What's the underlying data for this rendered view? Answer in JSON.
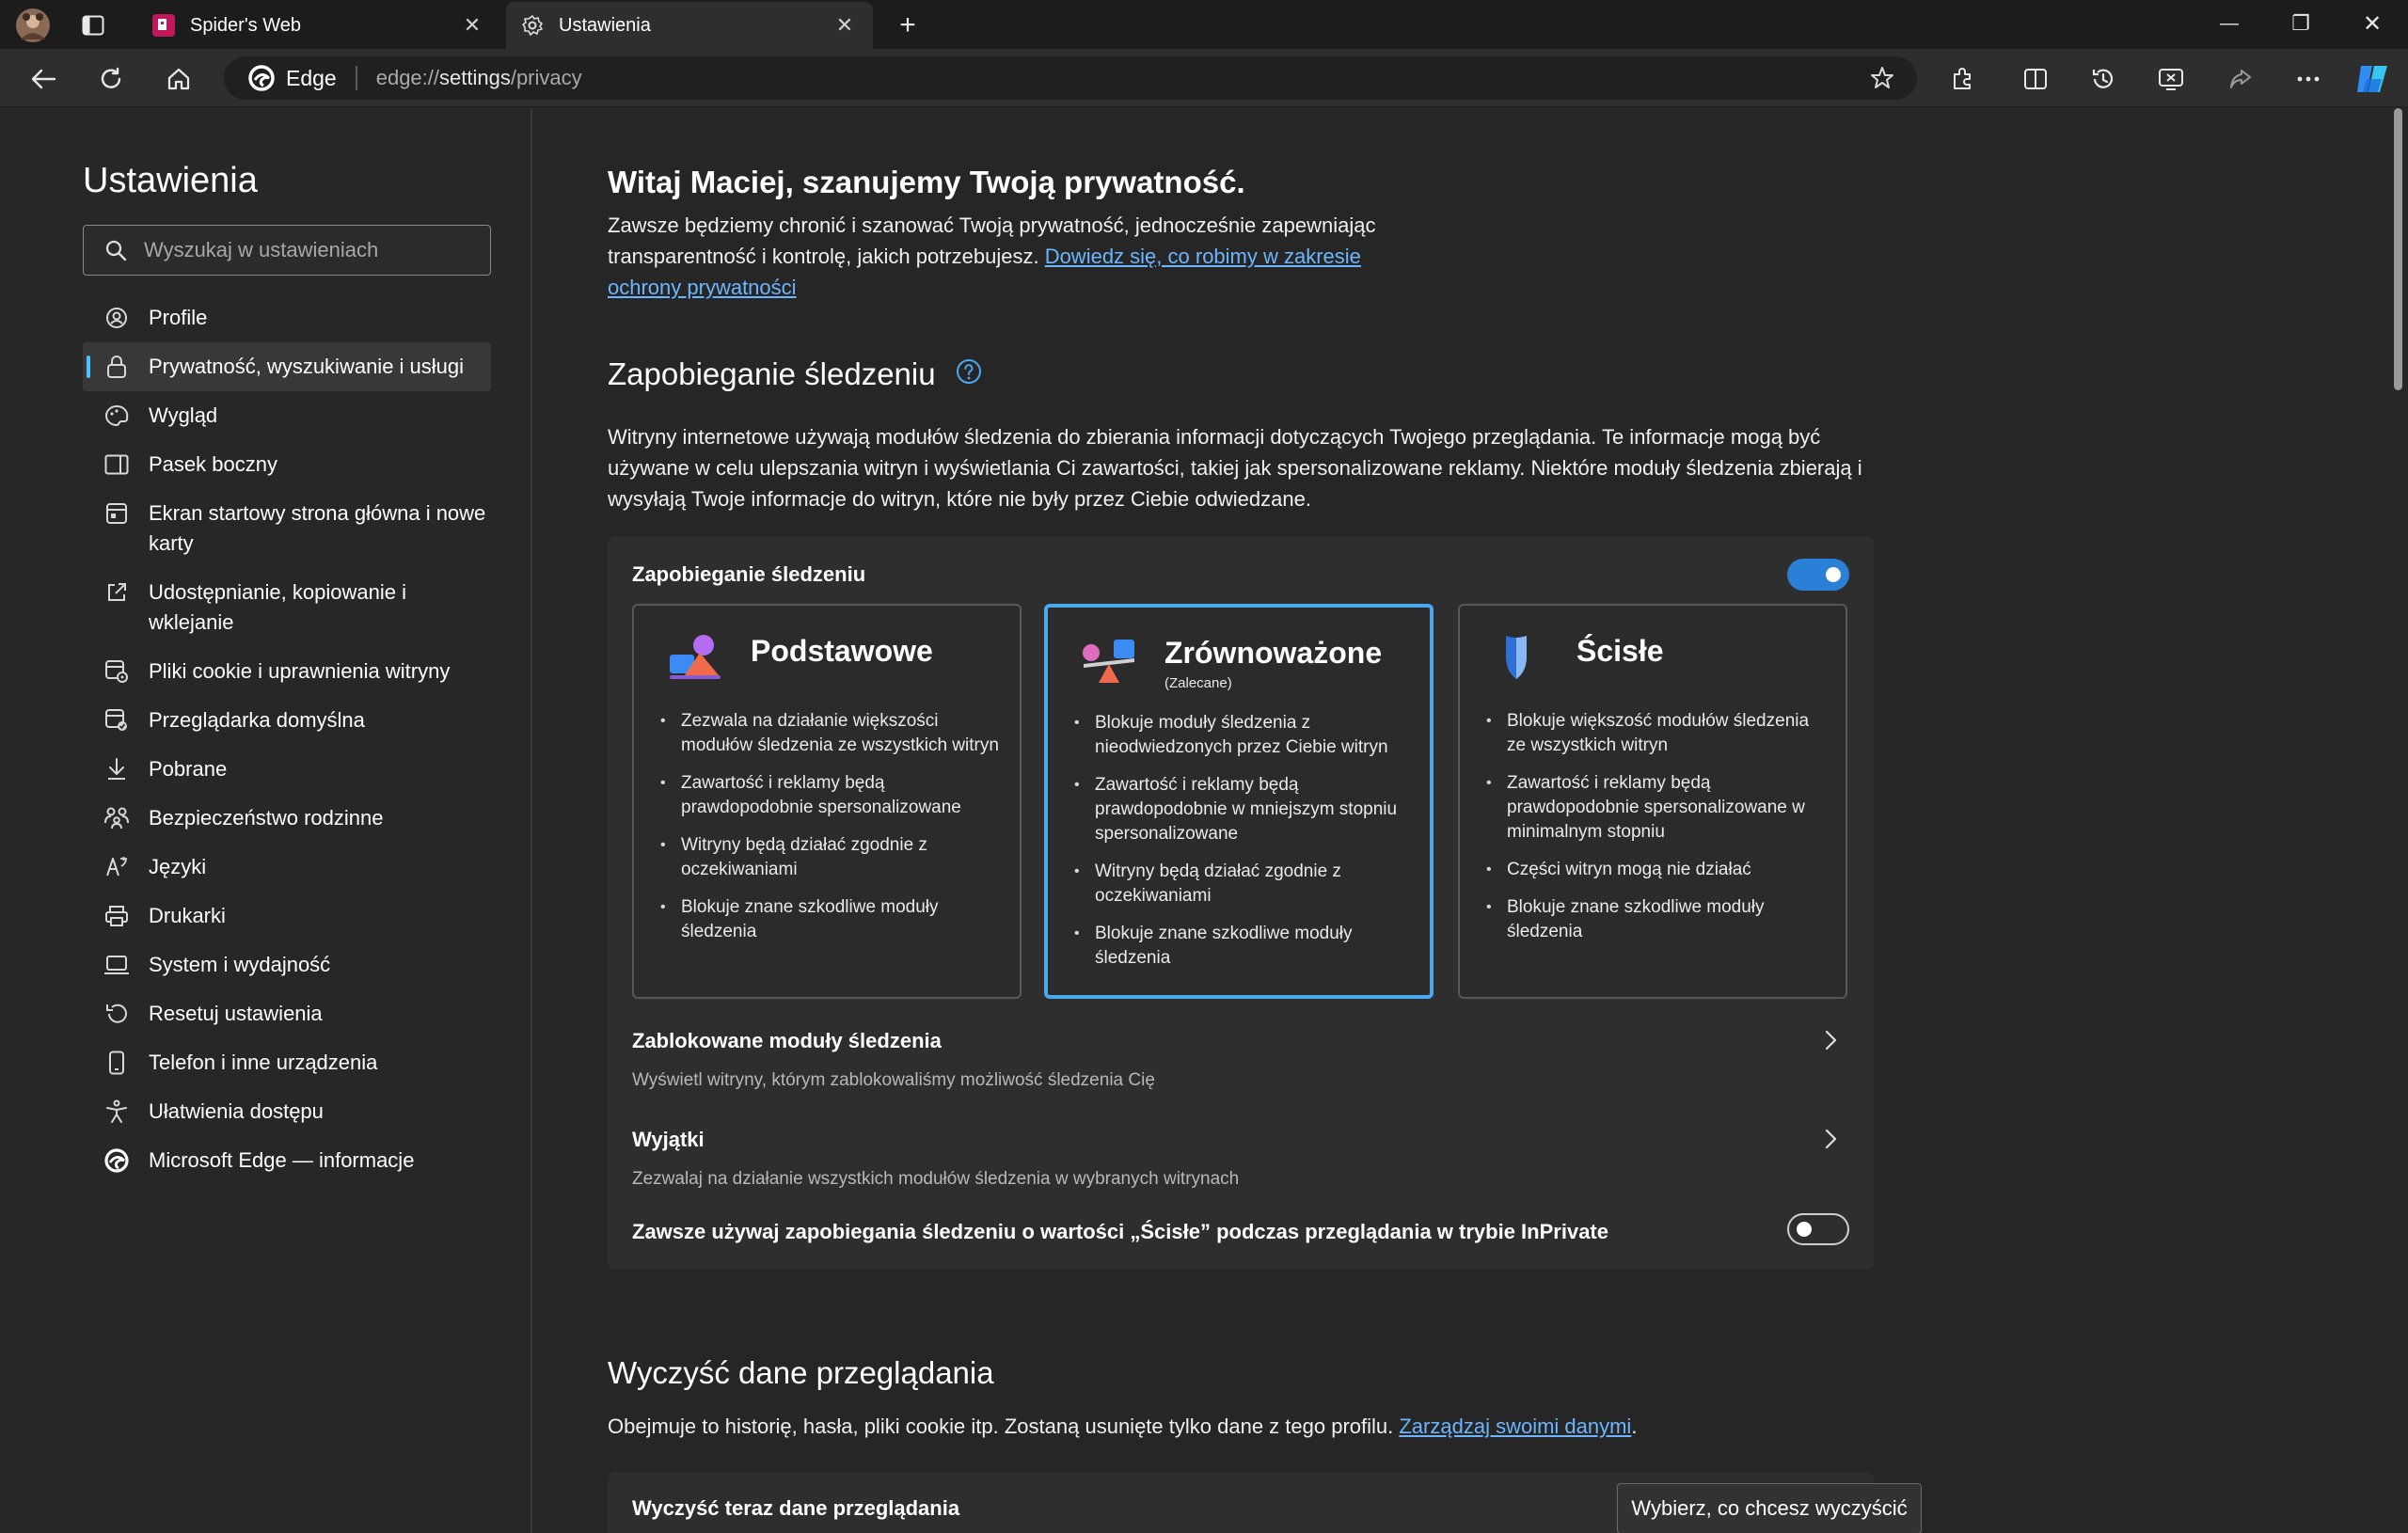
{
  "browser": {
    "tabs": [
      {
        "title": "Spider's Web",
        "close": "✕"
      },
      {
        "title": "Ustawienia",
        "close": "✕"
      }
    ],
    "new_tab": "+",
    "window_controls": {
      "minimize": "—",
      "restore": "❐",
      "close": "✕"
    },
    "address": {
      "site_name": "Edge",
      "url_prefix": "edge://",
      "url_host": "settings",
      "url_path": "/privacy"
    },
    "accent_color": "#2a7fd6"
  },
  "sidebar": {
    "title": "Ustawienia",
    "search_placeholder": "Wyszukaj w ustawieniach",
    "items": [
      {
        "label": "Profile",
        "icon": "profile-icon"
      },
      {
        "label": "Prywatność, wyszukiwanie i usługi",
        "icon": "lock-icon",
        "selected": true
      },
      {
        "label": "Wygląd",
        "icon": "palette-icon"
      },
      {
        "label": "Pasek boczny",
        "icon": "sidebar-icon"
      },
      {
        "label": "Ekran startowy strona główna i nowe karty",
        "icon": "home-screen-icon"
      },
      {
        "label": "Udostępnianie, kopiowanie i wklejanie",
        "icon": "share-icon"
      },
      {
        "label": "Pliki cookie i uprawnienia witryny",
        "icon": "cookie-icon"
      },
      {
        "label": "Przeglądarka domyślna",
        "icon": "default-browser-icon"
      },
      {
        "label": "Pobrane",
        "icon": "download-icon"
      },
      {
        "label": "Bezpieczeństwo rodzinne",
        "icon": "family-icon"
      },
      {
        "label": "Języki",
        "icon": "language-icon"
      },
      {
        "label": "Drukarki",
        "icon": "printer-icon"
      },
      {
        "label": "System i wydajność",
        "icon": "laptop-icon"
      },
      {
        "label": "Resetuj ustawienia",
        "icon": "reset-icon"
      },
      {
        "label": "Telefon i inne urządzenia",
        "icon": "phone-icon"
      },
      {
        "label": "Ułatwienia dostępu",
        "icon": "accessibility-icon"
      },
      {
        "label": "Microsoft Edge — informacje",
        "icon": "edge-logo-icon"
      }
    ]
  },
  "main": {
    "welcome_title": "Witaj Maciej, szanujemy Twoją prywatność.",
    "welcome_text": "Zawsze będziemy chronić i szanować Twoją prywatność, jednocześnie zapewniając transparentność i kontrolę, jakich potrzebujesz. ",
    "welcome_link": "Dowiedz się, co robimy w zakresie ochrony prywatności",
    "tracking": {
      "heading": "Zapobieganie śledzeniu",
      "description": "Witryny internetowe używają modułów śledzenia do zbierania informacji dotyczących Twojego przeglądania. Te informacje mogą być używane w celu ulepszania witryn i wyświetlania Ci zawartości, takiej jak spersonalizowane reklamy. Niektóre moduły śledzenia zbierają i wysyłają Twoje informacje do witryn, które nie były przez Ciebie odwiedzane.",
      "toggle_label": "Zapobieganie śledzeniu",
      "toggle_on": true,
      "cards": [
        {
          "title": "Podstawowe",
          "subtitle": "",
          "bullets": [
            "Zezwala na działanie większości modułów śledzenia ze wszystkich witryn",
            "Zawartość i reklamy będą prawdopodobnie spersonalizowane",
            "Witryny będą działać zgodnie z oczekiwaniami",
            "Blokuje znane szkodliwe moduły śledzenia"
          ]
        },
        {
          "title": "Zrównoważone",
          "subtitle": "(Zalecane)",
          "selected": true,
          "bullets": [
            "Blokuje moduły śledzenia z nieodwiedzonych przez Ciebie witryn",
            "Zawartość i reklamy będą prawdopodobnie w mniejszym stopniu spersonalizowane",
            "Witryny będą działać zgodnie z oczekiwaniami",
            "Blokuje znane szkodliwe moduły śledzenia"
          ]
        },
        {
          "title": "Ścisłe",
          "subtitle": "",
          "bullets": [
            "Blokuje większość modułów śledzenia ze wszystkich witryn",
            "Zawartość i reklamy będą prawdopodobnie spersonalizowane w minimalnym stopniu",
            "Części witryn mogą nie działać",
            "Blokuje znane szkodliwe moduły śledzenia"
          ]
        }
      ],
      "blocked": {
        "title": "Zablokowane moduły śledzenia",
        "subtitle": "Wyświetl witryny, którym zablokowaliśmy możliwość śledzenia Cię"
      },
      "exceptions": {
        "title": "Wyjątki",
        "subtitle": "Zezwalaj na działanie wszystkich modułów śledzenia w wybranych witrynach"
      },
      "inprivate_label": "Zawsze używaj zapobiegania śledzeniu o wartości „Ścisłe” podczas przeglądania w trybie InPrivate",
      "inprivate_on": false
    },
    "clear": {
      "heading": "Wyczyść dane przeglądania",
      "text": "Obejmuje to historię, hasła, pliki cookie itp. Zostaną usunięte tylko dane z tego profilu. ",
      "link": "Zarządzaj swoimi danymi",
      "text_end": ".",
      "row_label": "Wyczyść teraz dane przeglądania",
      "button": "Wybierz, co chcesz wyczyścić"
    }
  }
}
